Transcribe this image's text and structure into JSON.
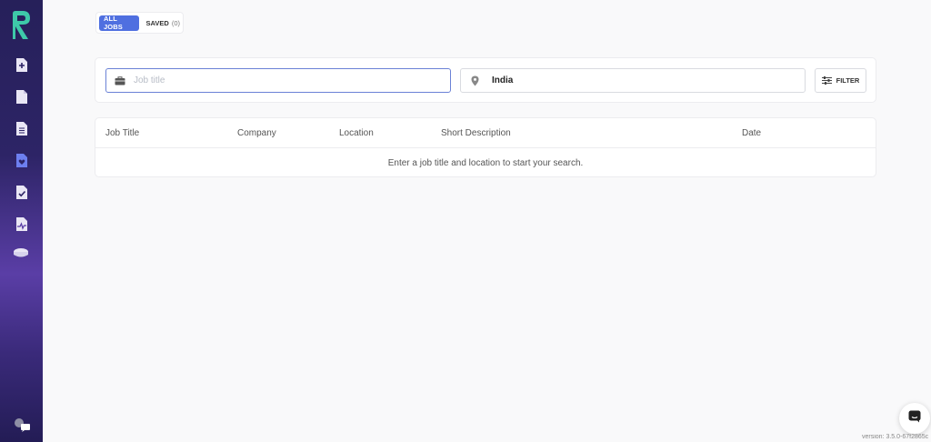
{
  "tabs": {
    "all_jobs": "ALL JOBS",
    "saved": "SAVED",
    "saved_count": "(0)"
  },
  "search": {
    "job_placeholder": "Job title",
    "job_value": "",
    "location_value": "India",
    "filter_label": "FILTER"
  },
  "table": {
    "columns": [
      "Job Title",
      "Company",
      "Location",
      "Short Description",
      "Date"
    ],
    "empty_message": "Enter a job title and location to start your search."
  },
  "footer": {
    "version": "version: 3.5.0-67f2865c"
  },
  "sidebar": {
    "items": [
      {
        "icon": "add-document-icon"
      },
      {
        "icon": "document-icon"
      },
      {
        "icon": "text-document-icon"
      },
      {
        "icon": "heart-document-icon"
      },
      {
        "icon": "check-document-icon"
      },
      {
        "icon": "activity-document-icon"
      },
      {
        "icon": "database-icon"
      }
    ],
    "bottom": {
      "icon": "help-chat-icon"
    }
  },
  "colors": {
    "accent": "#4f6fe0",
    "sidebar_top": "#26205a",
    "sidebar_mid": "#5a3ea6",
    "logo": "#3ec9a9"
  }
}
